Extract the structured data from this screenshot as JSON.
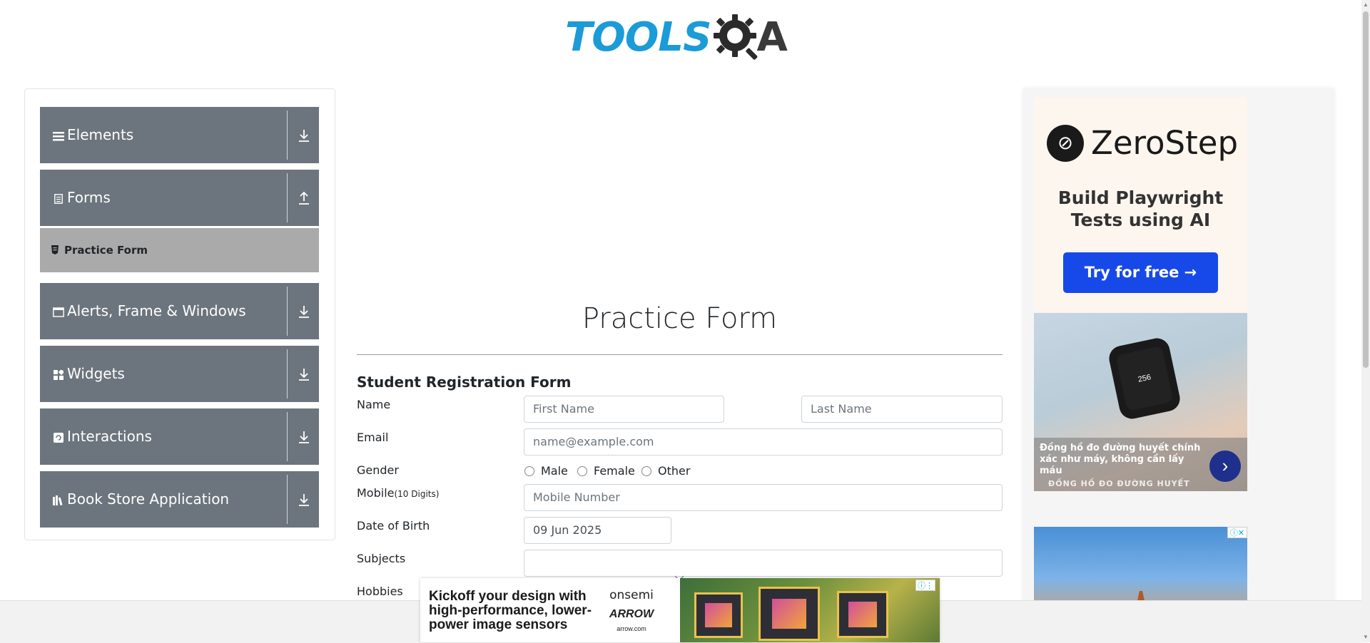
{
  "header": {
    "logo_text": "TOOLS",
    "logo_text_end": "A"
  },
  "sidebar": {
    "groups": [
      {
        "label": "Elements",
        "icon": "list-icon",
        "expanded": false
      },
      {
        "label": "Forms",
        "icon": "form-icon",
        "expanded": true
      },
      {
        "label": "Alerts, Frame & Windows",
        "icon": "window-icon",
        "expanded": false
      },
      {
        "label": "Widgets",
        "icon": "widgets-icon",
        "expanded": false
      },
      {
        "label": "Interactions",
        "icon": "interactions-icon",
        "expanded": false
      },
      {
        "label": "Book Store Application",
        "icon": "books-icon",
        "expanded": false
      }
    ],
    "active_item": "Practice Form"
  },
  "main": {
    "title": "Practice Form",
    "subtitle": "Student Registration Form",
    "name": {
      "label": "Name",
      "first_placeholder": "First Name",
      "last_placeholder": "Last Name"
    },
    "email": {
      "label": "Email",
      "placeholder": "name@example.com"
    },
    "gender": {
      "label": "Gender",
      "options": [
        "Male",
        "Female",
        "Other"
      ]
    },
    "mobile": {
      "label": "Mobile",
      "hint": "(10 Digits)",
      "placeholder": "Mobile Number"
    },
    "dob": {
      "label": "Date of Birth",
      "value": "09 Jun 2025"
    },
    "subjects": {
      "label": "Subjects",
      "value": ""
    },
    "hobbies": {
      "label": "Hobbies"
    }
  },
  "ads": {
    "zerostep": {
      "brand": "ZeroStep",
      "tagline_1": "Build Playwright",
      "tagline_2": "Tests using AI",
      "cta": "Try for free →"
    },
    "watch": {
      "text": "Đồng hồ đo đường huyết chính xác như máy, không cần lấy máu",
      "brand": "ĐỒNG HỒ ĐO ĐƯỜNG HUYẾT",
      "screen": "256"
    },
    "bottom": {
      "copy_1": "Kickoff your design with",
      "copy_2": "high-performance, lower-",
      "copy_3": "power image sensors",
      "brand_1": "onsemi",
      "brand_2": "ARROW",
      "brand_3": "arrow.com"
    }
  },
  "colors": {
    "nav_bg": "#6c757d",
    "active_item_bg": "#aaaaaa",
    "logo_blue": "#1b9bd7",
    "cta_blue": "#1749e8"
  }
}
